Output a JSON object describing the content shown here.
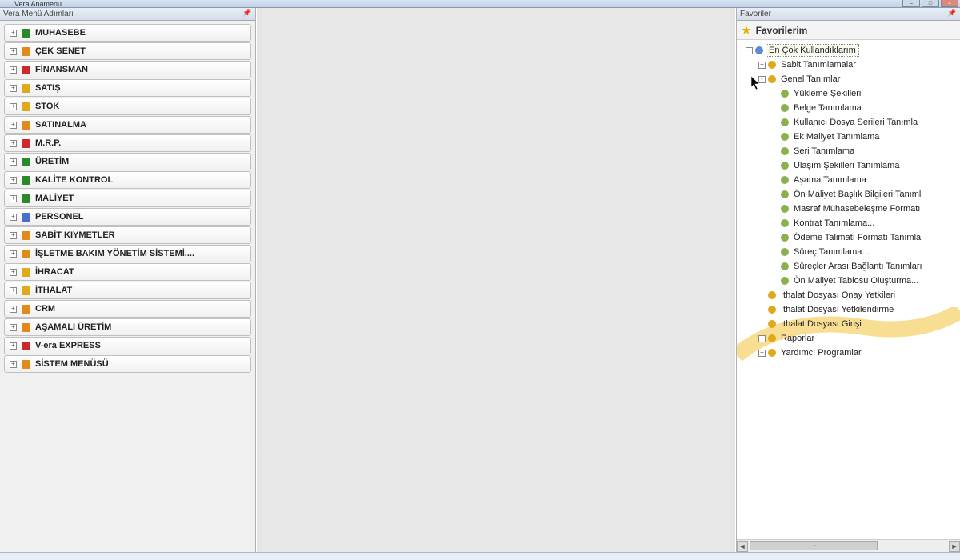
{
  "window": {
    "title": "Vera Anamenu"
  },
  "left_panel": {
    "header": "Vera Menü Adımları",
    "items": [
      {
        "label": "MUHASEBE",
        "color": "#2a8a2a"
      },
      {
        "label": "ÇEK SENET",
        "color": "#e08a1a"
      },
      {
        "label": "FİNANSMAN",
        "color": "#cc2a2a"
      },
      {
        "label": "SATIŞ",
        "color": "#e0a81a"
      },
      {
        "label": "STOK",
        "color": "#e0a81a"
      },
      {
        "label": "SATINALMA",
        "color": "#e08a1a"
      },
      {
        "label": "M.R.P.",
        "color": "#cc2a2a"
      },
      {
        "label": "ÜRETİM",
        "color": "#2a8a2a"
      },
      {
        "label": "KALİTE KONTROL",
        "color": "#2a8a2a"
      },
      {
        "label": "MALİYET",
        "color": "#2a8a2a"
      },
      {
        "label": "PERSONEL",
        "color": "#4a6ecc"
      },
      {
        "label": "SABİT KIYMETLER",
        "color": "#e08a1a"
      },
      {
        "label": "İŞLETME BAKIM YÖNETİM SİSTEMİ....",
        "color": "#e08a1a"
      },
      {
        "label": "İHRACAT",
        "color": "#e0a81a"
      },
      {
        "label": "İTHALAT",
        "color": "#e0a81a"
      },
      {
        "label": "CRM",
        "color": "#e08a1a"
      },
      {
        "label": "AŞAMALI ÜRETİM",
        "color": "#e08a1a"
      },
      {
        "label": "V-era EXPRESS",
        "color": "#cc2a2a"
      },
      {
        "label": "SİSTEM MENÜSÜ",
        "color": "#e08a1a"
      }
    ]
  },
  "right_panel": {
    "header": "Favoriler",
    "root_label": "Favorilerim",
    "nodes": [
      {
        "depth": 0,
        "toggle": "-",
        "icon": "#5a8ad8",
        "label": "En Çok Kullandıklarım",
        "boxed": true
      },
      {
        "depth": 1,
        "toggle": "+",
        "icon": "#e0a81a",
        "label": "Sabit Tanımlamalar"
      },
      {
        "depth": 1,
        "toggle": "-",
        "icon": "#e0a81a",
        "label": "Genel Tanımlar"
      },
      {
        "depth": 2,
        "toggle": "",
        "icon": "#8ab050",
        "label": "Yükleme Şekilleri"
      },
      {
        "depth": 2,
        "toggle": "",
        "icon": "#8ab050",
        "label": "Belge Tanımlama"
      },
      {
        "depth": 2,
        "toggle": "",
        "icon": "#8ab050",
        "label": "Kullanıcı Dosya Serileri Tanımla"
      },
      {
        "depth": 2,
        "toggle": "",
        "icon": "#8ab050",
        "label": "Ek Maliyet Tanımlama"
      },
      {
        "depth": 2,
        "toggle": "",
        "icon": "#8ab050",
        "label": "Seri Tanımlama"
      },
      {
        "depth": 2,
        "toggle": "",
        "icon": "#8ab050",
        "label": "Ulaşım Şekilleri Tanımlama"
      },
      {
        "depth": 2,
        "toggle": "",
        "icon": "#8ab050",
        "label": "Aşama Tanımlama"
      },
      {
        "depth": 2,
        "toggle": "",
        "icon": "#8ab050",
        "label": "Ön Maliyet Başlık Bilgileri Tanıml"
      },
      {
        "depth": 2,
        "toggle": "",
        "icon": "#8ab050",
        "label": "Masraf Muhasebeleşme Formatı"
      },
      {
        "depth": 2,
        "toggle": "",
        "icon": "#8ab050",
        "label": "Kontrat Tanımlama..."
      },
      {
        "depth": 2,
        "toggle": "",
        "icon": "#8ab050",
        "label": "Ödeme Talimatı Formatı Tanımla"
      },
      {
        "depth": 2,
        "toggle": "",
        "icon": "#8ab050",
        "label": "Süreç Tanımlama..."
      },
      {
        "depth": 2,
        "toggle": "",
        "icon": "#8ab050",
        "label": "Süreçler Arası Bağlantı Tanımları"
      },
      {
        "depth": 2,
        "toggle": "",
        "icon": "#8ab050",
        "label": "Ön Maliyet Tablosu Oluşturma..."
      },
      {
        "depth": 1,
        "toggle": "",
        "icon": "#e0a81a",
        "label": "İthalat Dosyası Onay Yetkileri"
      },
      {
        "depth": 1,
        "toggle": "",
        "icon": "#e0a81a",
        "label": "İthalat Dosyası Yetkilendirme"
      },
      {
        "depth": 1,
        "toggle": "",
        "icon": "#e0a81a",
        "label": "İthalat Dosyası Girişi"
      },
      {
        "depth": 1,
        "toggle": "+",
        "icon": "#e0a81a",
        "label": "Raporlar"
      },
      {
        "depth": 1,
        "toggle": "+",
        "icon": "#e0a81a",
        "label": "Yardımcı Programlar"
      }
    ]
  }
}
